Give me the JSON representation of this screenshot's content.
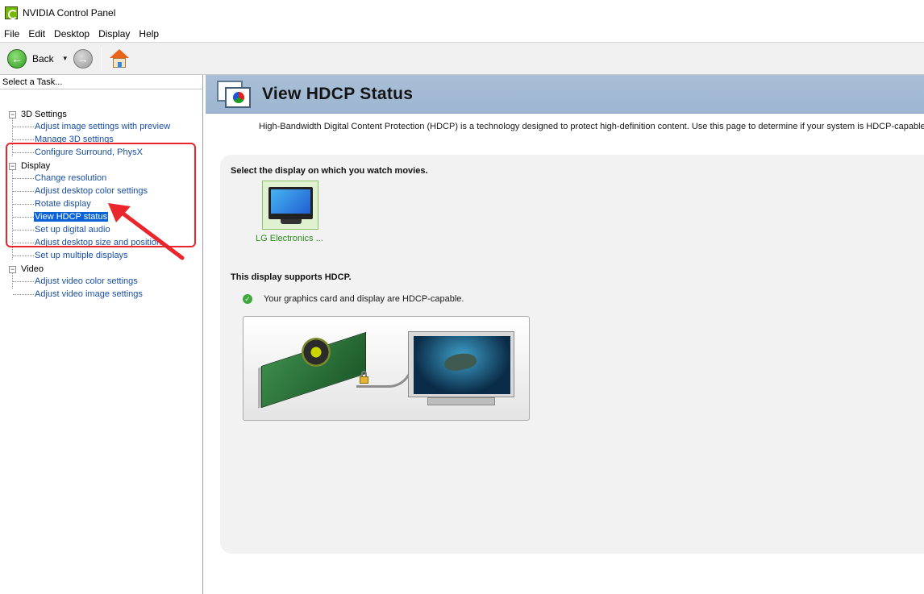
{
  "window": {
    "title": "NVIDIA Control Panel"
  },
  "menu": [
    "File",
    "Edit",
    "Desktop",
    "Display",
    "Help"
  ],
  "toolbar": {
    "back_label": "Back"
  },
  "sidebar": {
    "header": "Select a Task...",
    "groups": [
      {
        "label": "3D Settings",
        "items": [
          "Adjust image settings with preview",
          "Manage 3D settings",
          "Configure Surround, PhysX"
        ]
      },
      {
        "label": "Display",
        "items": [
          "Change resolution",
          "Adjust desktop color settings",
          "Rotate display",
          "View HDCP status",
          "Set up digital audio",
          "Adjust desktop size and position",
          "Set up multiple displays"
        ]
      },
      {
        "label": "Video",
        "items": [
          "Adjust video color settings",
          "Adjust video image settings"
        ]
      }
    ],
    "selected_item": "View HDCP status"
  },
  "main": {
    "title": "View HDCP Status",
    "description": "High-Bandwidth Digital Content Protection (HDCP) is a technology designed to protect high-definition content. Use this page to determine if your system is HDCP-capable.",
    "select_label": "Select the display on which you watch movies.",
    "display_name": "LG Electronics ...",
    "support_label": "This display supports HDCP.",
    "capable_text": "Your graphics card and display are HDCP-capable."
  },
  "colors": {
    "link": "#1a4fa6",
    "selection": "#0a64d8",
    "header_bg": "#a9bfd7",
    "annotation": "#e8262c",
    "success": "#3da93a"
  }
}
